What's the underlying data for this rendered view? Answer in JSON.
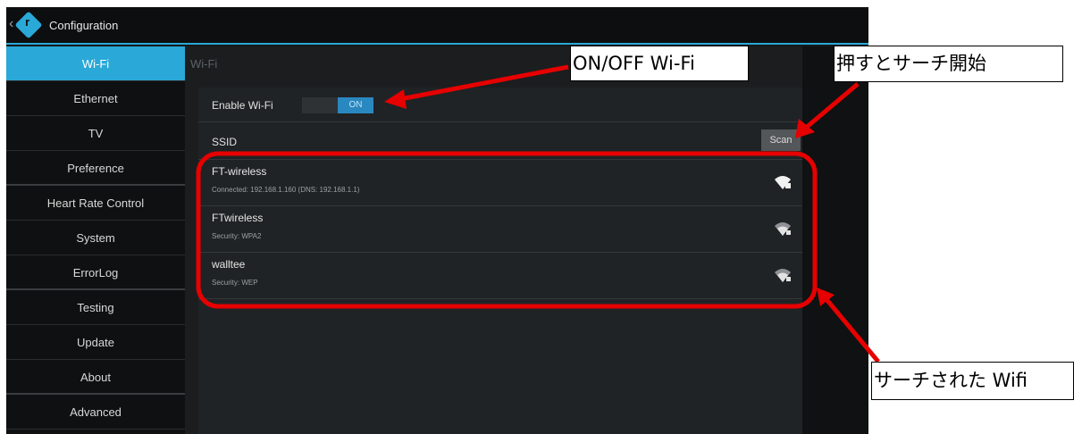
{
  "titlebar": {
    "back": "‹",
    "logo_glyph": "r",
    "title": "Configuration"
  },
  "sidebar": {
    "items": [
      {
        "label": "Wi-Fi",
        "active": true
      },
      {
        "label": "Ethernet"
      },
      {
        "label": "TV"
      },
      {
        "label": "Preference"
      },
      {
        "label": "Heart Rate Control"
      },
      {
        "label": "System"
      },
      {
        "label": "ErrorLog"
      },
      {
        "label": "Testing"
      },
      {
        "label": "Update"
      },
      {
        "label": "About"
      },
      {
        "label": "Advanced"
      }
    ]
  },
  "content": {
    "header": "Wi-Fi",
    "enable_label": "Enable Wi-Fi",
    "toggle_state": "ON",
    "ssid_label": "SSID",
    "scan_label": "Scan",
    "networks": [
      {
        "name": "FT-wireless",
        "detail": "Connected: 192.168.1.160 (DNS: 192.168.1.1)",
        "icon": "wifi-signal-icon"
      },
      {
        "name": "FTwireless",
        "detail": "Security: WPA2",
        "icon": "wifi-secured-icon"
      },
      {
        "name": "walltee",
        "detail": "Security: WEP",
        "icon": "wifi-secured-icon"
      }
    ]
  },
  "annotations": {
    "onoff": "ON/OFF Wi-Fi",
    "search_start": "押すとサーチ開始",
    "searched_wifi": "サーチされた Wifi"
  },
  "colors": {
    "accent": "#2aa8d8",
    "annotation_red": "#e60000",
    "background": "#16181a"
  }
}
